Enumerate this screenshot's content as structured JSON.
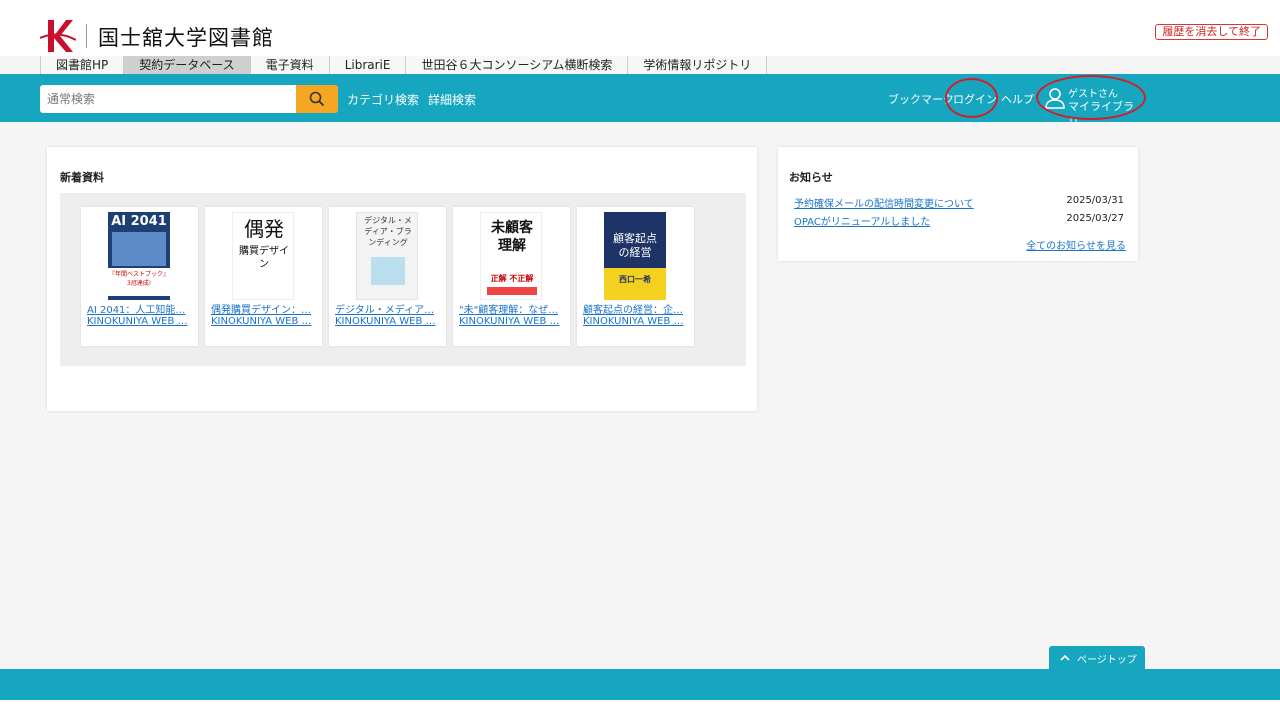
{
  "header": {
    "logo_sub": "Kokushikan",
    "university": "国士舘大学図書館",
    "clear_history": "履歴を消去して終了"
  },
  "tabs": [
    {
      "label": "図書館HP",
      "active": false
    },
    {
      "label": "契約データベース",
      "active": true
    },
    {
      "label": "電子資料",
      "active": false
    },
    {
      "label": "LibrariE",
      "active": false
    },
    {
      "label": "世田谷６大コンソーシアム横断検索",
      "active": false
    },
    {
      "label": "学術情報リポジトリ",
      "active": false
    }
  ],
  "search": {
    "placeholder": "通常検索",
    "category": "カテゴリ検索",
    "advanced": "詳細検索"
  },
  "nav": {
    "bookmark": "ブックマーク",
    "login": "ログイン",
    "help": "ヘルプ",
    "guest": "ゲストさん",
    "mylibrary": "マイライブラリ"
  },
  "new_items": {
    "title": "新着資料",
    "books": [
      {
        "title": "AI 2041：人工知能…",
        "source": "KINOKUNIYA WEB …",
        "cover_text": "AI 2041",
        "cover_sub": "『年間ベストブック』3冠達成!"
      },
      {
        "title": "偶発購買デザイン：…",
        "source": "KINOKUNIYA WEB …",
        "cover_text": "偶発",
        "cover_sub": "購買デザイン"
      },
      {
        "title": "デジタル・メディア…",
        "source": "KINOKUNIYA WEB …",
        "cover_text": "デジタル・メディア・ブランディング",
        "cover_sub": ""
      },
      {
        "title": "\"未\"顧客理解：なぜ…",
        "source": "KINOKUNIYA WEB …",
        "cover_text": "未顧客理解",
        "cover_sub": "正解 不正解"
      },
      {
        "title": "顧客起点の経営：企…",
        "source": "KINOKUNIYA WEB …",
        "cover_text": "顧客起点の経営",
        "cover_sub": "西口一希"
      }
    ]
  },
  "news": {
    "title": "お知らせ",
    "items": [
      {
        "text": "予約確保メールの配信時間変更について",
        "date": "2025/03/31"
      },
      {
        "text": "OPACがリニューアルしました",
        "date": "2025/03/27"
      }
    ],
    "see_all": "全てのお知らせを見る"
  },
  "page_top": "ページトップ",
  "colors": {
    "accent": "#16a6bf",
    "search_button": "#f5a623",
    "link": "#1a73c8",
    "highlight_circle": "#d21e2b"
  }
}
